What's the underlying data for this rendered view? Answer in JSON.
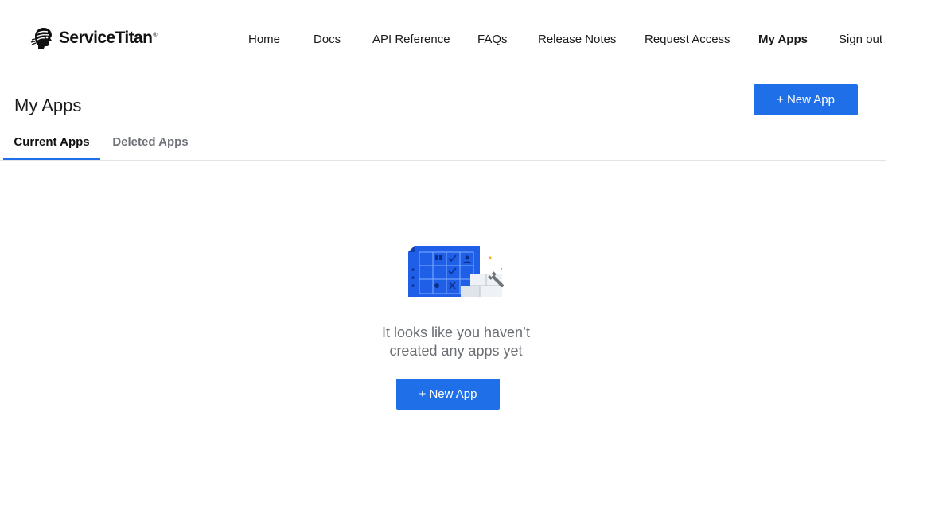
{
  "brand": {
    "name": "ServiceTitan",
    "registered_mark": "®",
    "accent_color": "#1f6fe8"
  },
  "nav": {
    "items": [
      {
        "label": "Home",
        "active": false
      },
      {
        "label": "Docs",
        "active": false
      },
      {
        "label": "API Reference",
        "active": false
      },
      {
        "label": "FAQs",
        "active": false
      },
      {
        "label": "Release Notes",
        "active": false
      },
      {
        "label": "Request Access",
        "active": false
      },
      {
        "label": "My Apps",
        "active": true
      },
      {
        "label": "Sign out",
        "active": false
      }
    ]
  },
  "page": {
    "title": "My Apps",
    "new_app_label": "+ New App"
  },
  "tabs": [
    {
      "label": "Current Apps",
      "selected": true
    },
    {
      "label": "Deleted Apps",
      "selected": false
    }
  ],
  "empty_state": {
    "illustration_icon": "blueprint-grid-with-wrench-icon",
    "message_line1": "It looks like you haven’t",
    "message_line2": "created any apps yet",
    "button_label": "+ New App"
  }
}
